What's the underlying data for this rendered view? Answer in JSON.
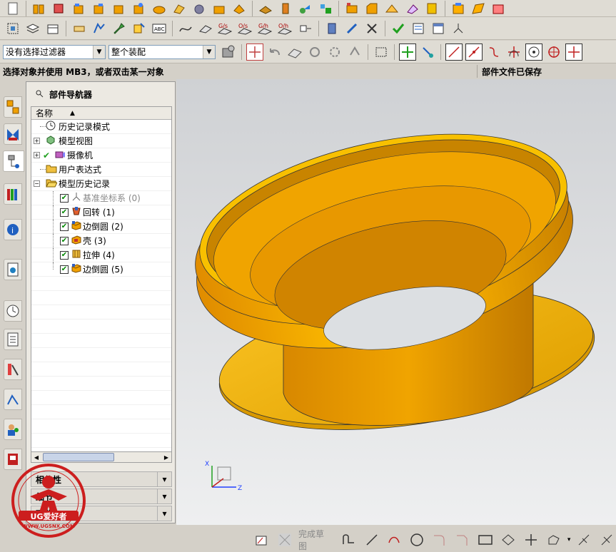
{
  "toolbar_top": {
    "icons": [
      "new-file-icon",
      "pattern-icon",
      "boolean-icon",
      "block-icon",
      "cylinder-icon",
      "cone-icon",
      "sphere-icon",
      "revolve-icon",
      "extrude-icon",
      "hole-icon",
      "boss-icon",
      "pocket-icon",
      "pad-icon",
      "slot-icon",
      "groove-icon",
      "thread-icon",
      "blend-icon",
      "chamfer-icon",
      "shell-icon",
      "draft-icon",
      "mirror-icon",
      "offset-icon",
      "trim-icon",
      "split-icon"
    ]
  },
  "toolbar_second": {
    "labels": [
      "G/s",
      "O/s",
      "G/h",
      "O/h"
    ]
  },
  "filter_select": {
    "value": "没有选择过滤器"
  },
  "assembly_select": {
    "value": "整个装配"
  },
  "status": {
    "prompt": "选择对象并使用 MB3，或者双击某一对象",
    "right": "部件文件已保存"
  },
  "navigator": {
    "title": "部件导航器",
    "column": "名称",
    "items": [
      {
        "label": "历史记录模式",
        "icon": "clock-icon"
      },
      {
        "label": "模型视图",
        "icon": "model-view-icon"
      },
      {
        "label": "摄像机",
        "icon": "camera-icon"
      },
      {
        "label": "用户表达式",
        "icon": "folder-icon"
      },
      {
        "label": "模型历史记录",
        "icon": "folder-open-icon"
      }
    ],
    "features": [
      {
        "label": "基准坐标系 (0)",
        "checked": true,
        "grayed": true,
        "icon": "datum-csys-icon"
      },
      {
        "label": "回转 (1)",
        "checked": true,
        "icon": "revolve-icon"
      },
      {
        "label": "边倒圆 (2)",
        "checked": true,
        "icon": "edge-blend-icon"
      },
      {
        "label": "壳 (3)",
        "checked": true,
        "icon": "shell-icon"
      },
      {
        "label": "拉伸 (4)",
        "checked": true,
        "icon": "extrude-icon"
      },
      {
        "label": "边倒圆 (5)",
        "checked": true,
        "icon": "edge-blend-icon"
      }
    ],
    "sections": [
      "相依性",
      "细节",
      "预览"
    ]
  },
  "triad": {
    "x": "X",
    "z": "Z"
  },
  "bottom_toolbar": {
    "finish_sketch": "完成草图"
  },
  "logo": {
    "text": "UG爱好者",
    "url": "WWW.UGSNX.COM"
  },
  "colors": {
    "model": "#f5b800",
    "model_dark": "#c88a00",
    "viewport_top": "#cfd1d4",
    "logo_red": "#cc1e1e"
  }
}
